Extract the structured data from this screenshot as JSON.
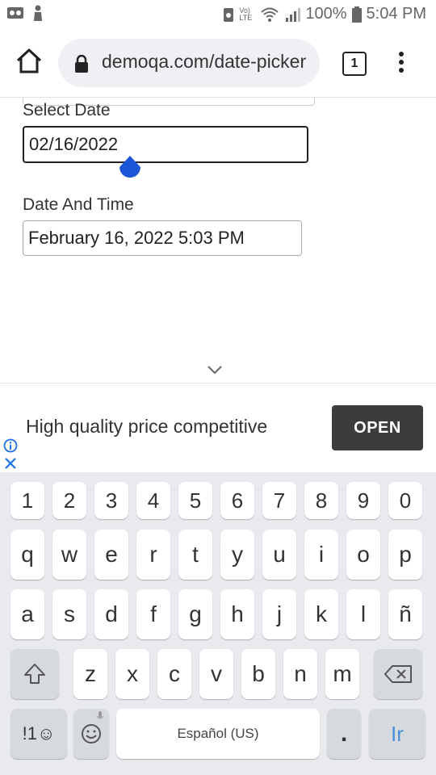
{
  "status_bar": {
    "battery": "100%",
    "time": "5:04 PM",
    "network": "Vo) LTE"
  },
  "browser": {
    "url": "demoqa.com/date-picker",
    "tab_count": "1"
  },
  "form": {
    "select_date_label": "Select Date",
    "select_date_value": "02/16/2022",
    "date_time_label": "Date And Time",
    "date_time_value": "February 16, 2022 5:03 PM"
  },
  "ad": {
    "text": "High quality price competitive",
    "button": "OPEN"
  },
  "keyboard": {
    "numbers": [
      "1",
      "2",
      "3",
      "4",
      "5",
      "6",
      "7",
      "8",
      "9",
      "0"
    ],
    "row1": [
      "q",
      "w",
      "e",
      "r",
      "t",
      "y",
      "u",
      "i",
      "o",
      "p"
    ],
    "row2": [
      "a",
      "s",
      "d",
      "f",
      "g",
      "h",
      "j",
      "k",
      "l",
      "ñ"
    ],
    "row3": [
      "z",
      "x",
      "c",
      "v",
      "b",
      "n",
      "m"
    ],
    "symbols_label": "!1☺",
    "space_label": "Español (US)",
    "period": ".",
    "go_label": "Ir"
  },
  "colors": {
    "accent_handle": "#1a56d6",
    "go_key_text": "#4a90d9",
    "ad_button_bg": "#3c3c3c",
    "keyboard_bg": "#e8eaed"
  }
}
